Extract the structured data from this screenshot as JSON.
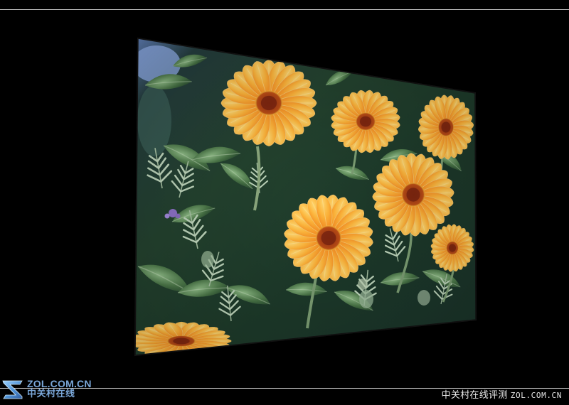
{
  "watermark": {
    "site": "ZOL.COM.CN",
    "brand": "中关村在线",
    "logo_icon": "zol-logo-icon"
  },
  "caption": {
    "brand": "中关村在线评测",
    "domain": "ZOL.COM.CN"
  },
  "colors": {
    "background": "#000000",
    "rule": "#d8d8d8",
    "watermark": "#7aa7d9",
    "petal": "#f28a1e",
    "petal_light": "#ffc15a",
    "center": "#b4481c",
    "foliage": "#5f8e55"
  }
}
